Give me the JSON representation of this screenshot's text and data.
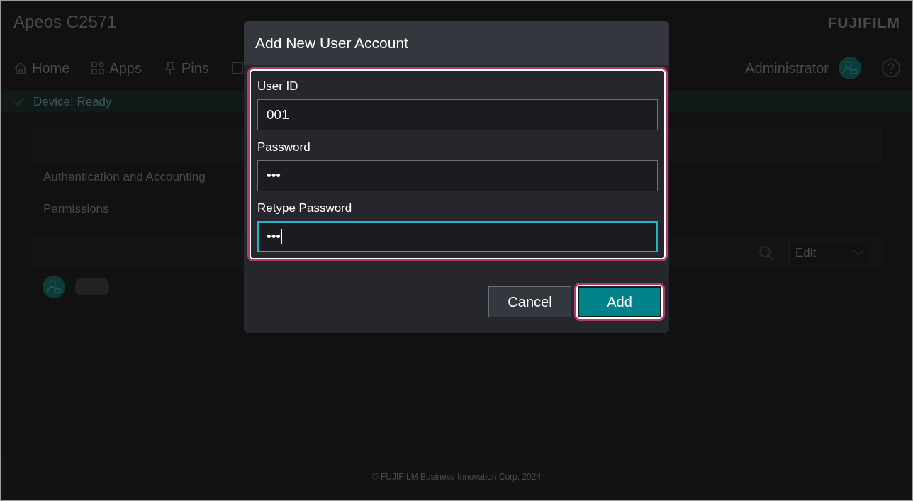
{
  "header": {
    "title": "Apeos C2571",
    "logo": "FUJIFILM"
  },
  "nav": {
    "items": [
      {
        "label": "Home",
        "kind": "home"
      },
      {
        "label": "Apps",
        "kind": "apps"
      },
      {
        "label": "Pins",
        "kind": "pins"
      },
      {
        "kind": "doc"
      }
    ],
    "user": "Administrator"
  },
  "status_bar": {
    "text": "Device: Ready"
  },
  "settings": {
    "rows": [
      "Authentication and Accounting",
      "Permissions"
    ],
    "edit_menu": "Edit"
  },
  "dialog": {
    "title": "Add New User Account",
    "fields": [
      {
        "label": "User ID",
        "value": "001",
        "focused": false
      },
      {
        "label": "Password",
        "value": "•••",
        "focused": false
      },
      {
        "label": "Retype Password",
        "value": "•••",
        "focused": true
      }
    ],
    "buttons": [
      {
        "label": "Cancel",
        "kind": "secondary"
      },
      {
        "label": "Add",
        "kind": "primary"
      }
    ]
  },
  "footer": "© FUJIFILM Business Innovation Corp. 2024"
}
